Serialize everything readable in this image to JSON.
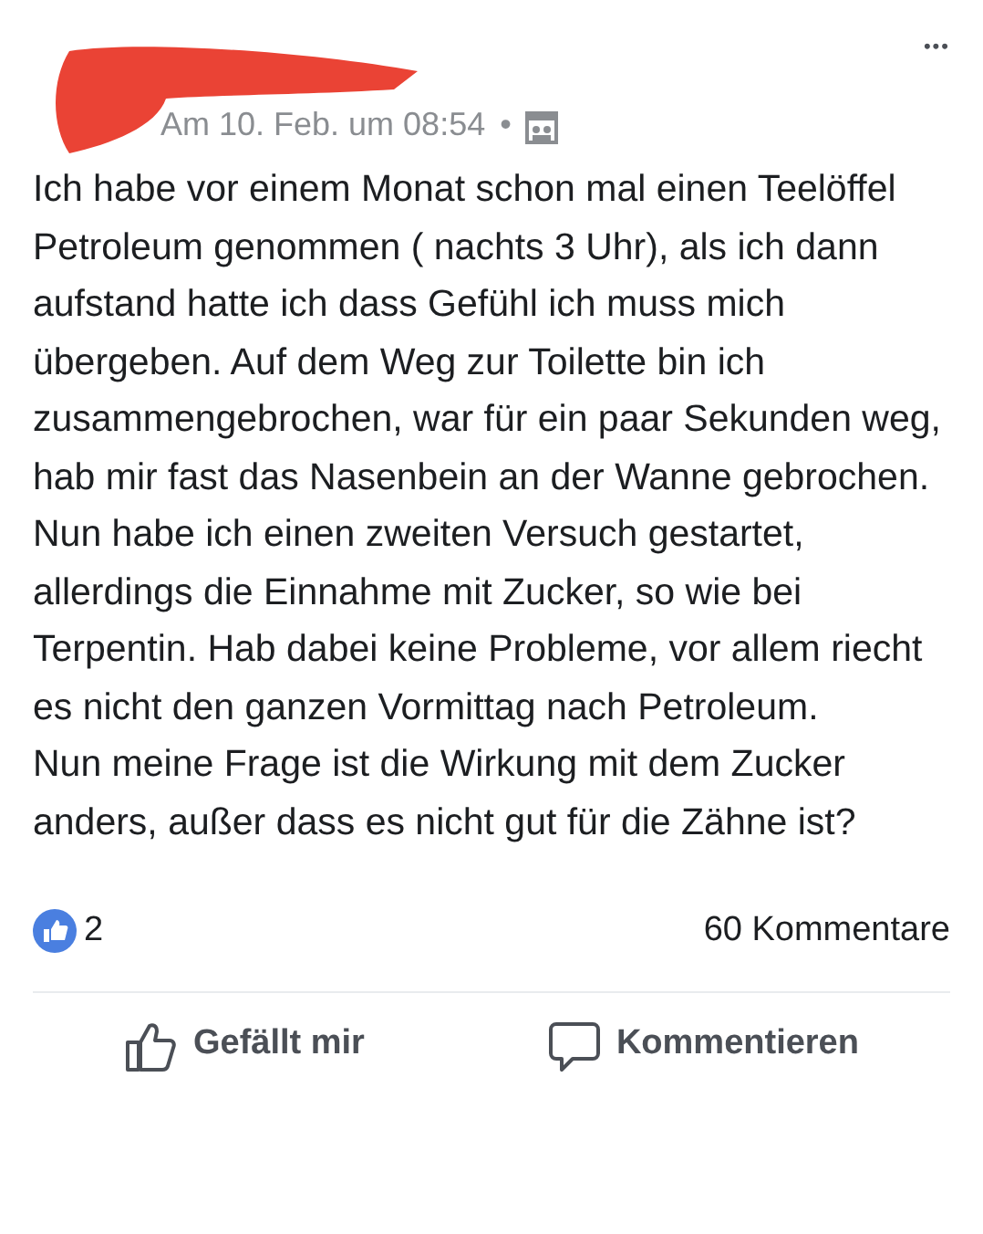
{
  "post": {
    "timestamp": "Am 10. Feb. um 08:54",
    "separator": "•",
    "more": "•••",
    "paragraphs": [
      "Ich habe vor einem Monat schon mal einen Teelöffel Petroleum genommen ( nachts 3 Uhr), als ich dann aufstand hatte ich dass Gefühl ich muss mich übergeben. Auf dem Weg zur Toilette bin ich zusammengebrochen, war für ein paar Sekunden weg, hab mir fast das Nasenbein an der Wanne gebrochen.",
      "Nun habe ich einen zweiten Versuch gestartet, allerdings die Einnahme mit Zucker, so wie bei Terpentin. Hab dabei keine Probleme, vor allem riecht es nicht den ganzen Vormittag nach Petroleum.",
      "Nun meine Frage ist die Wirkung mit dem Zucker anders, außer dass es nicht gut für die Zähne ist?"
    ],
    "like_count": "2",
    "comment_count": "60 Kommentare",
    "actions": [
      {
        "kind": "like",
        "label": "Gefällt mir"
      },
      {
        "kind": "comment",
        "label": "Kommentieren"
      }
    ]
  }
}
